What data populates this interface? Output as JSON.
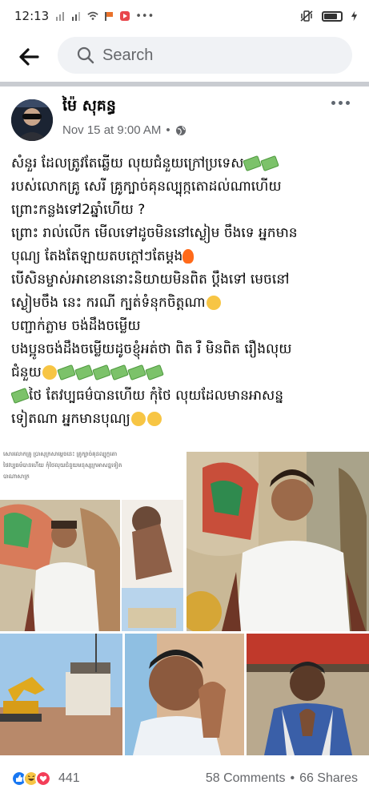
{
  "status_bar": {
    "time": "12:13"
  },
  "search": {
    "placeholder": "Search"
  },
  "post": {
    "author": "ម៉ៃ សុគន្ធ",
    "date": "Nov 15 at 9:00 AM",
    "dot": "•",
    "lines": [
      "សំនួរ ដែលត្រូវតែឆ្លើយ  លុយជំនួយក្រៅប្រទេស",
      "របស់លោកគ្រូ សេរី គ្រូក្បាច់គុនល្បុក្កតោដល់ណាហើយ",
      "ព្រោះកន្លងទៅ2ឆ្នាំហើយ ?",
      "ព្រោះ រាល់លើក មើលទៅដូចមិននៅស្ងៀម ចឹងទេ អ្នកមាន",
      "បុណ្យ តែងតែឡាយតបក្ដៅៗតែម្ដង",
      "បើសិនម្ចាស់អាខោននោះនិយាយមិនពិត ប្ដឹងទៅ មេចនៅ",
      "ស្ងៀមចឹង នេះ ករណី ក្បត់ទំនុកចិត្តណា",
      "បញ្ជាក់ភ្លាម ចង់ដឹងចម្លើយ",
      "បងប្អូនចង់ដឹងចម្លើយដូចខ្ញុំអត់ថា ពិត រឺ មិនពិត រឿងលុយ",
      "ជំនួយ",
      "ថៃ តែវប្បធម៌បានហើយ កុំថៃ លុយដែលមានអាសន្ន",
      "ទៀតណា អ្នកមានបុណ្យ"
    ],
    "overlay_line1": "សោរលោកគ្រូ ប្រាសុក្រសាម្ដេចនេះ គ្រូក្បាច់គុនល្បុក្កតោ",
    "overlay_line2": "ថៃវប្បធម៌បានហើយ កុំថៃលុយជំនួយមនុស្សក្រអាសន្នទៀត",
    "overlay_line3": "បាណាសាក្រ",
    "reactions_count": "441",
    "comments": "58 Comments",
    "separator": "•",
    "shares": "66 Shares"
  },
  "colors": {
    "like": "#1877f2",
    "haha": "#f7c544",
    "love": "#f33e58"
  },
  "icons": [
    "back-arrow-icon",
    "search-icon",
    "globe-icon",
    "more-dots-icon"
  ]
}
